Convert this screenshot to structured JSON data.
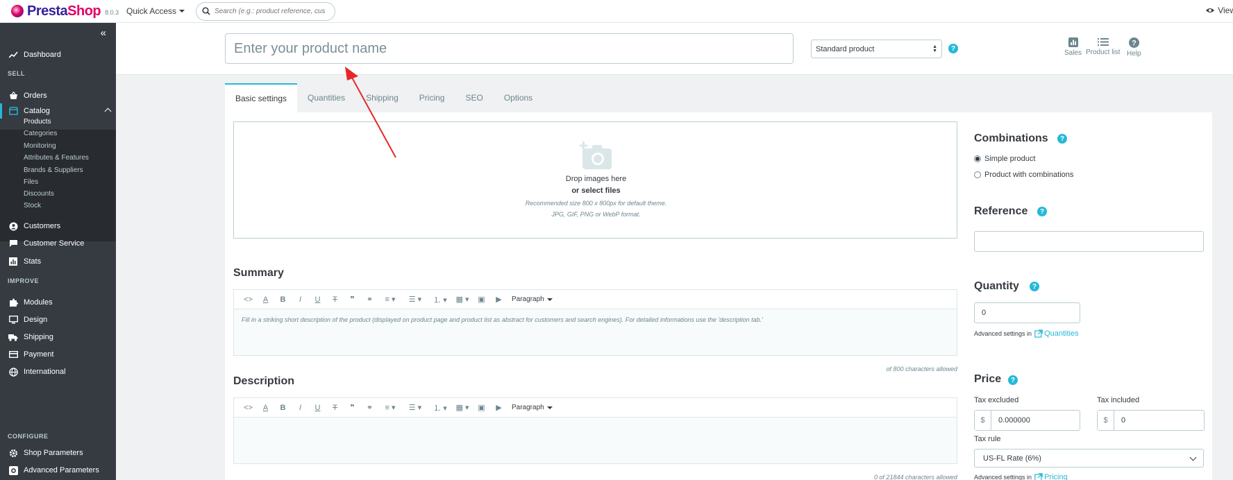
{
  "topbar": {
    "logo_text_1": "Presta",
    "logo_text_2": "Shop",
    "version": "8.0.3",
    "quick_access": "Quick Access",
    "search_placeholder": "Search (e.g.: product reference, custon",
    "view_link": "View"
  },
  "sidebar": {
    "dashboard": "Dashboard",
    "section_sell": "SELL",
    "orders": "Orders",
    "catalog": "Catalog",
    "catalog_sub": [
      "Products",
      "Categories",
      "Monitoring",
      "Attributes & Features",
      "Brands & Suppliers",
      "Files",
      "Discounts",
      "Stock"
    ],
    "customers": "Customers",
    "customer_service": "Customer Service",
    "stats": "Stats",
    "section_improve": "IMPROVE",
    "modules": "Modules",
    "design": "Design",
    "shipping": "Shipping",
    "payment": "Payment",
    "international": "International",
    "section_configure": "CONFIGURE",
    "shop_parameters": "Shop Parameters",
    "advanced_parameters": "Advanced Parameters"
  },
  "header": {
    "name_placeholder": "Enter your product name",
    "product_type": "Standard product",
    "tools": [
      "Sales",
      "Product list",
      "Help"
    ]
  },
  "tabs": [
    "Basic settings",
    "Quantities",
    "Shipping",
    "Pricing",
    "SEO",
    "Options"
  ],
  "dropzone": {
    "line1": "Drop images here",
    "line2": "or select files",
    "hint1": "Recommended size 800 x 800px for default theme.",
    "hint2": "JPG, GIF, PNG or WebP format."
  },
  "summary": {
    "title": "Summary",
    "paragraph": "Paragraph",
    "placeholder": "Fill in a striking short description of the product (displayed on product page and product list as abstract for customers and search engines). For detailed informations use the 'description tab.'",
    "count": "of 800 characters allowed"
  },
  "description": {
    "title": "Description",
    "paragraph": "Paragraph",
    "count": "0 of 21844 characters allowed"
  },
  "right": {
    "combinations_title": "Combinations",
    "simple": "Simple product",
    "with_combinations": "Product with combinations",
    "reference_title": "Reference",
    "reference_value": "",
    "quantity_title": "Quantity",
    "quantity_value": "0",
    "adv_settings": "Advanced settings in",
    "quantities_link": "Quantities",
    "price_title": "Price",
    "tax_excluded_label": "Tax excluded",
    "tax_included_label": "Tax included",
    "currency": "$",
    "tax_excluded_value": "0.000000",
    "tax_included_value": "0",
    "tax_rule_label": "Tax rule",
    "tax_rule_value": "US-FL Rate (6%)",
    "pricing_link": "Pricing"
  },
  "colors": {
    "accent": "#25b9d7",
    "sidebar_bg": "#363a41",
    "annotation_arrow": "#e8262a"
  }
}
